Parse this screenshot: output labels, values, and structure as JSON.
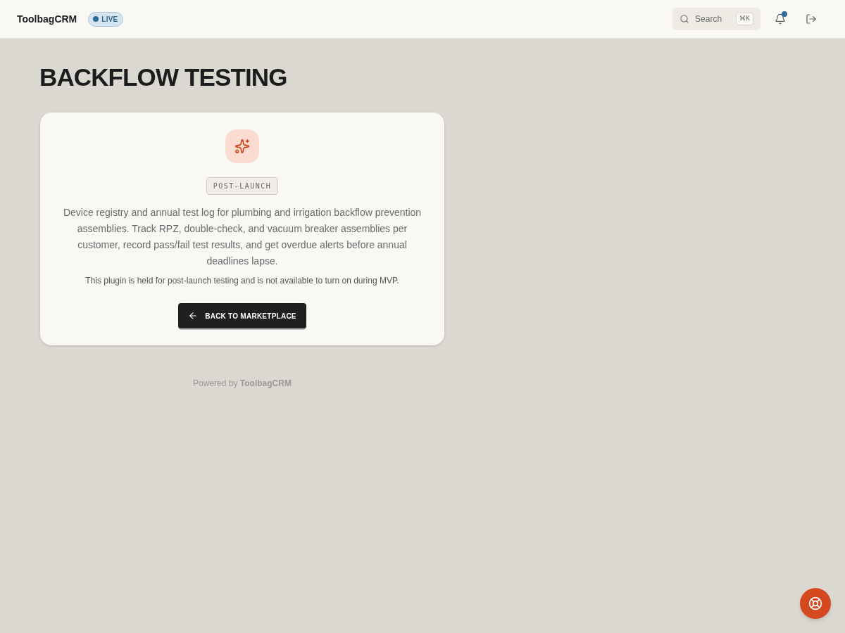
{
  "header": {
    "brand": "ToolbagCRM",
    "status_badge": {
      "label": "LIVE"
    },
    "search": {
      "label": "Search",
      "shortcut": "⌘K"
    },
    "notifications": {
      "unread": true
    }
  },
  "page": {
    "title": "BACKFLOW TESTING"
  },
  "card": {
    "badge": "POST-LAUNCH",
    "description": "Device registry and annual test log for plumbing and irrigation backflow prevention assemblies. Track RPZ, double-check, and vacuum breaker assemblies per customer, record pass/fail test results, and get overdue alerts before annual deadlines lapse.",
    "note": "This plugin is held for post-launch testing and is not available to turn on during MVP.",
    "button": {
      "label": "BACK TO MARKETPLACE"
    }
  },
  "footer": {
    "text": "Powered by **ToolbagCRM**"
  }
}
